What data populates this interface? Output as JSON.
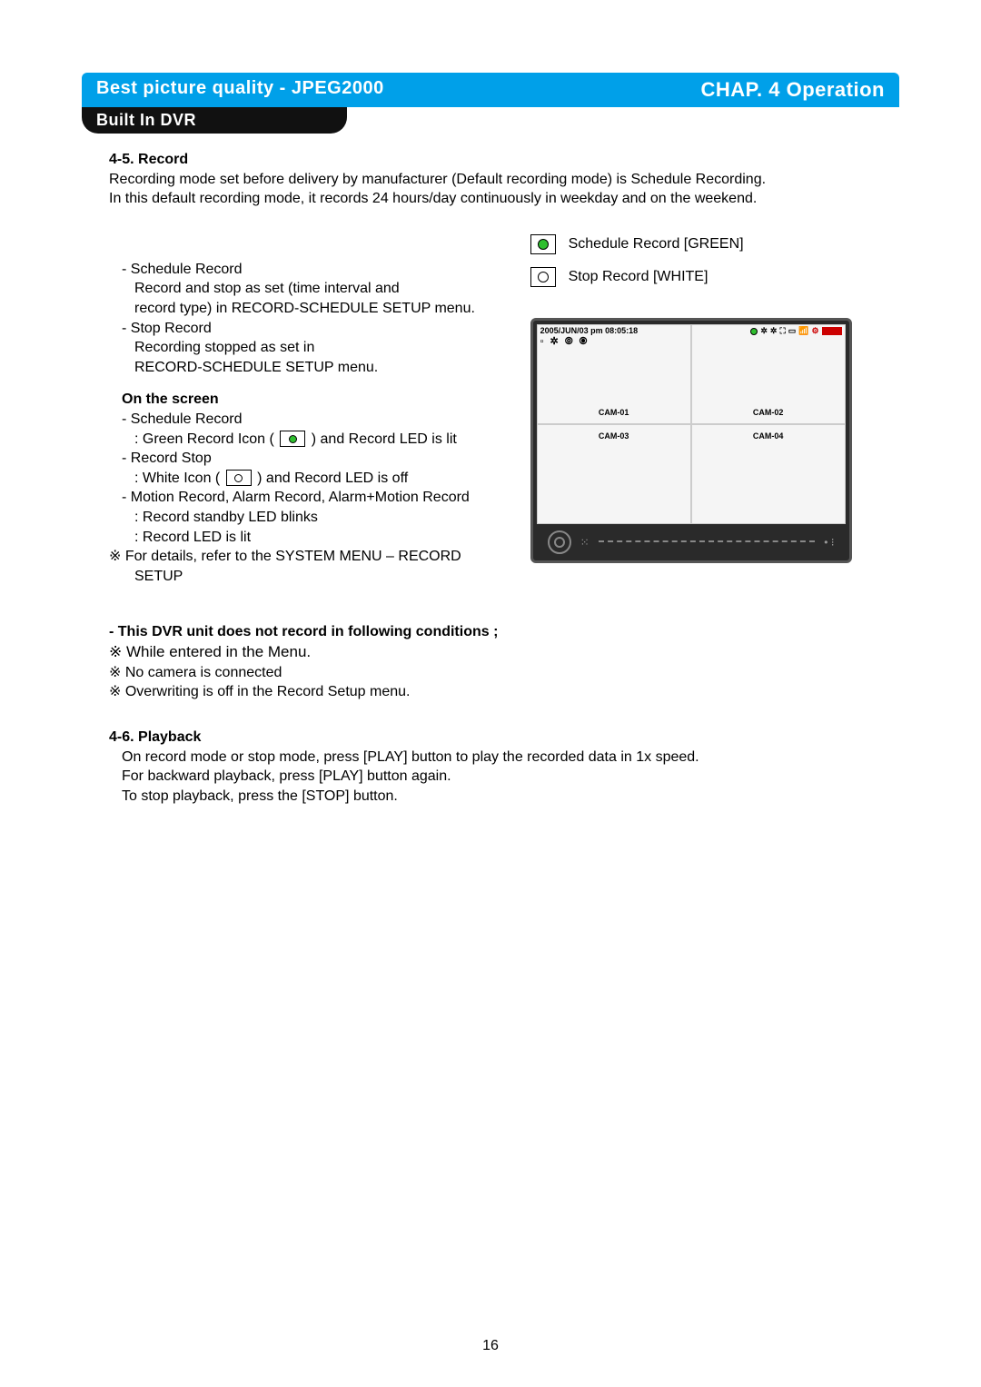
{
  "header": {
    "left": "Best picture quality - JPEG2000",
    "right": "CHAP. 4  Operation",
    "sub": "Built In DVR"
  },
  "record": {
    "title": "4-5. Record",
    "intro1": "Recording mode set before delivery by manufacturer (Default recording mode) is Schedule Recording.",
    "intro2": "In this default recording mode, it records 24 hours/day continuously in weekday and on the weekend.",
    "schedule_label": "- Schedule Record",
    "schedule_desc1": "Record and stop as set (time interval and",
    "schedule_desc2": "record type) in RECORD-SCHEDULE SETUP  menu.",
    "stop_label": "- Stop Record",
    "stop_desc1": "Recording stopped as set in",
    "stop_desc2": "RECORD-SCHEDULE SETUP menu.",
    "screen_title": "On the screen",
    "screen_l1": "- Schedule Record",
    "screen_l1b_pre": ": Green Record Icon (",
    "screen_l1b_post": ") and Record LED is lit",
    "screen_l2": "- Record Stop",
    "screen_l2b_pre": ": White Icon (",
    "screen_l2b_post": ") and Record LED is off",
    "screen_l3": "- Motion Record, Alarm Record, Alarm+Motion Record",
    "screen_l3a": ": Record standby LED blinks",
    "screen_l3b": ": Record LED is lit",
    "footnote1": "※ For details, refer to the SYSTEM MENU – RECORD",
    "footnote1b": "SETUP"
  },
  "legend": {
    "green": "Schedule Record [GREEN]",
    "white": "Stop Record [WHITE]"
  },
  "dvr": {
    "timestamp": "2005/JUN/03 pm 08:05:18",
    "cam1": "CAM-01",
    "cam2": "CAM-02",
    "cam3": "CAM-03",
    "cam4": "CAM-04"
  },
  "conditions": {
    "title": "- This DVR unit does not record in following conditions ;",
    "c1": "※ While entered in the Menu.",
    "c2": "※ No camera is connected",
    "c3": "※ Overwriting is off in the Record Setup menu."
  },
  "playback": {
    "title": "4-6. Playback",
    "l1": "On record mode or stop mode, press [PLAY] button to play the recorded data in 1x speed.",
    "l2": "For backward playback, press [PLAY] button again.",
    "l3": "To stop playback, press the [STOP] button."
  },
  "page_number": "16"
}
